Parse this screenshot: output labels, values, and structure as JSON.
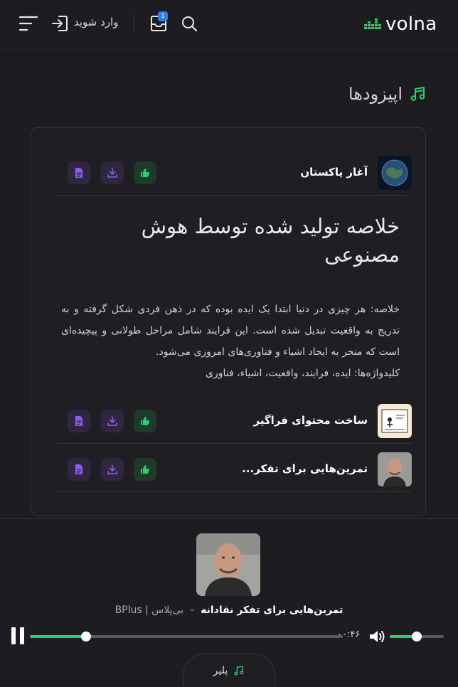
{
  "header": {
    "logo_text": "volna",
    "login_label": "وارد شوید",
    "inbox_badge": "1",
    "icons": [
      "menu-icon",
      "login-icon",
      "inbox-icon",
      "search-icon"
    ]
  },
  "section": {
    "title": "اپیزودها",
    "icon": "music-note-icon"
  },
  "episodes": [
    {
      "title": "آغاز پاکستان",
      "thumb": "earth-thumb"
    },
    {
      "title": "ساخت محتوای فراگیر",
      "thumb": "illustration-thumb"
    },
    {
      "title": "تمرین‌هایی برای تفکر...",
      "thumb": "man-thumb"
    }
  ],
  "ai_summary": {
    "title": "خلاصه تولید شده توسط هوش مصنوعی",
    "text": "خلاصه: هر چیزی در دنیا ابتدا یک ایده بوده که در ذهن فردی شکل گرفته و به تدریج به واقعیت تبدیل شده است. این فرایند شامل مراحل طولانی و پیچیده‌ای است که منجر به ایجاد اشیاء و فناوری‌های امروزی می‌شود.",
    "keywords": "کلیدواژه‌ها: ایده، فرایند، واقعیت، اشیاء، فناوری"
  },
  "player": {
    "now_playing_title": "تمرین‌هایی برای تفکر نقادانه",
    "separator": "–",
    "podcast": "بی‌پلاس | BPlus",
    "elapsed": "۰۰:۴۶",
    "progress": 0.18,
    "volume": 0.5,
    "tab_label": "پلیر"
  },
  "colors": {
    "accent_green": "#2ecc71",
    "action_purple": "#8a5cf6",
    "badge_blue": "#2f7fe8"
  }
}
